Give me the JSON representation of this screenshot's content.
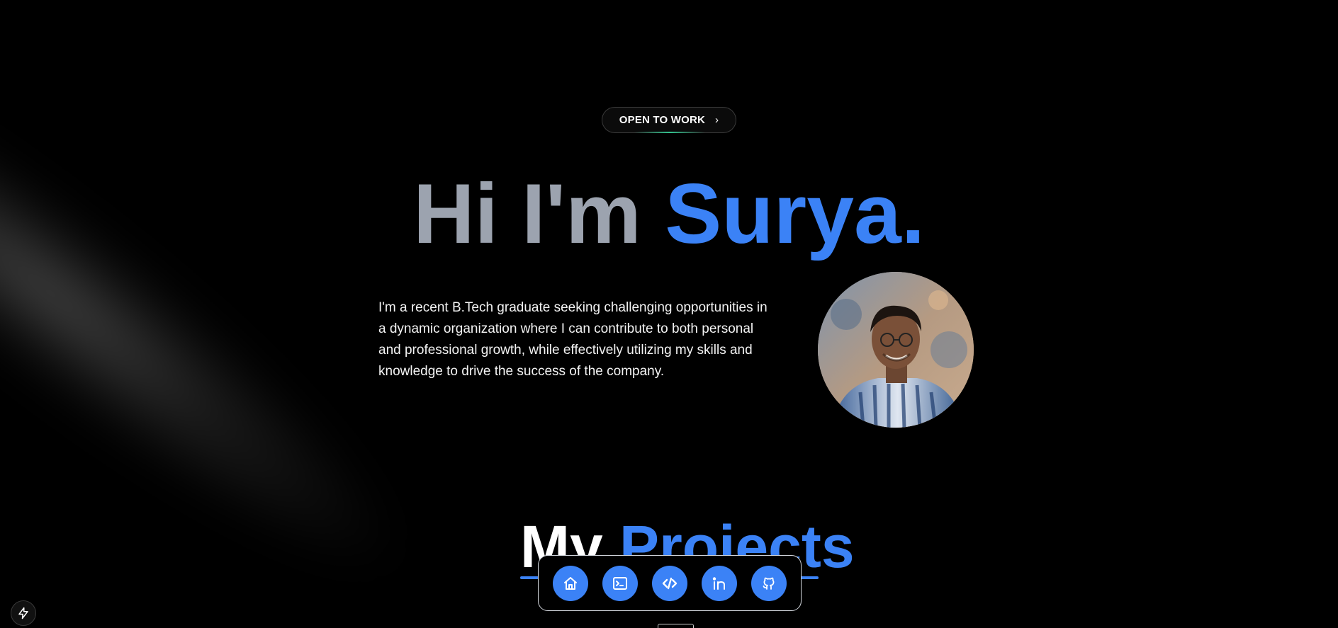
{
  "badge": {
    "label": "OPEN TO WORK",
    "chevron": "›"
  },
  "hero": {
    "greeting": "Hi I'm",
    "name": "Surya.",
    "bio": "I'm a recent B.Tech graduate seeking challenging opportunities in a dynamic organization where I can contribute to both personal and professional growth, while effectively utilizing my skills and knowledge to drive the success of the company."
  },
  "projects": {
    "title_prefix": "My",
    "title_highlight": "Projects"
  },
  "dock": {
    "items": [
      {
        "icon": "home-icon"
      },
      {
        "icon": "terminal-icon"
      },
      {
        "icon": "code-icon"
      },
      {
        "icon": "linkedin-icon"
      },
      {
        "icon": "github-icon"
      }
    ]
  },
  "corner_button": {
    "icon": "lightning-icon"
  },
  "colors": {
    "accent": "#3b82f6",
    "greeting": "#9ca3af",
    "background": "#000000",
    "badge_glow": "#34d399"
  }
}
